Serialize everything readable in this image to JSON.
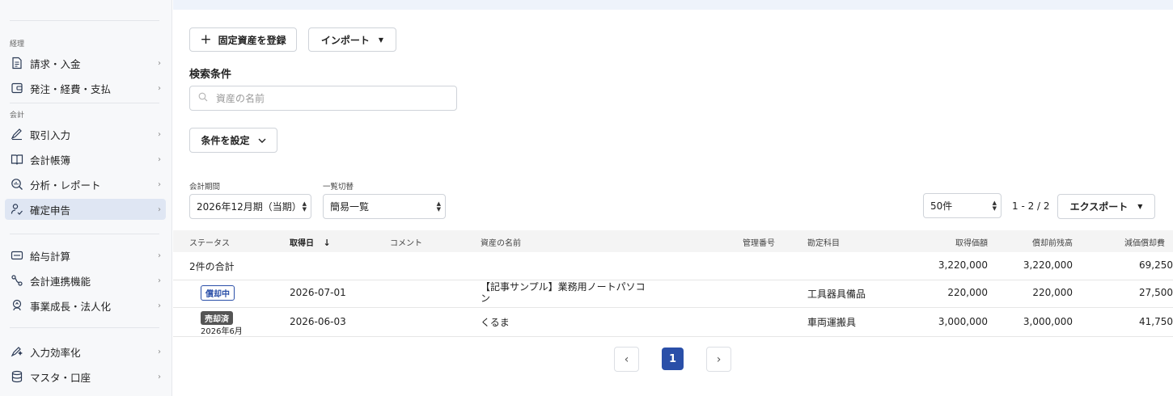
{
  "sidebar": {
    "sections": [
      {
        "label": "経理"
      },
      {
        "label": "会計"
      }
    ],
    "items": [
      {
        "label": "請求・入金",
        "icon": "invoice-icon"
      },
      {
        "label": "発注・経費・支払",
        "icon": "wallet-icon"
      },
      {
        "label": "取引入力",
        "icon": "pen-icon"
      },
      {
        "label": "会計帳簿",
        "icon": "book-icon"
      },
      {
        "label": "分析・レポート",
        "icon": "magnifier-chart-icon"
      },
      {
        "label": "確定申告",
        "icon": "person-check-icon"
      },
      {
        "label": "給与計算",
        "icon": "card-icon"
      },
      {
        "label": "会計連携機能",
        "icon": "link-icon"
      },
      {
        "label": "事業成長・法人化",
        "icon": "growth-icon"
      },
      {
        "label": "入力効率化",
        "icon": "pen-spark-icon"
      },
      {
        "label": "マスタ・口座",
        "icon": "database-icon"
      }
    ],
    "chevron": "›"
  },
  "toolbar": {
    "register_label": "固定資産を登録",
    "import_label": "インポート"
  },
  "search": {
    "heading": "検索条件",
    "placeholder": "資産の名前"
  },
  "conditions_label": "条件を設定",
  "filters": {
    "period_label": "会計期間",
    "period_value": "2026年12月期（当期）",
    "view_label": "一覧切替",
    "view_value": "簡易一覧",
    "per_page_value": "50件",
    "range_text": "1 - 2 / 2",
    "export_label": "エクスポート"
  },
  "table": {
    "headers": {
      "status": "ステータス",
      "acquired": "取得日",
      "comment": "コメント",
      "name": "資産の名前",
      "mgmt_no": "管理番号",
      "account": "勘定科目",
      "cost": "取得価額",
      "balance": "償却前残高",
      "depreciation": "減価償却費"
    },
    "total": {
      "label": "2件の合計",
      "cost": "3,220,000",
      "balance": "3,220,000",
      "depreciation": "69,250"
    },
    "rows": [
      {
        "status": "償却中",
        "status_sub": "",
        "acquired": "2026-07-01",
        "name_line1": "【記事サンプル】業務用ノートパソコ",
        "name_line2": "ン",
        "account": "工具器具備品",
        "cost": "220,000",
        "balance": "220,000",
        "depreciation": "27,500"
      },
      {
        "status": "売却済",
        "status_sub": "2026年6月",
        "acquired": "2026-06-03",
        "name_line1": "くるま",
        "name_line2": "",
        "account": "車両運搬具",
        "cost": "3,000,000",
        "balance": "3,000,000",
        "depreciation": "41,750"
      }
    ]
  },
  "pagination": {
    "current": "1",
    "prev": "‹",
    "next": "›"
  },
  "colors": {
    "accent": "#2a4fa8",
    "sidebar_active": "#dfe6f3"
  }
}
